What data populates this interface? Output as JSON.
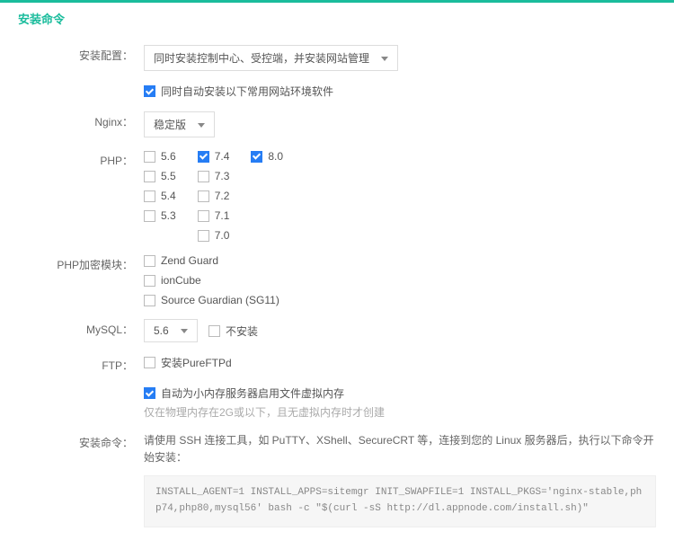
{
  "title": "安装命令",
  "rows": {
    "config_label": "安装配置：",
    "config_select": "同时安装控制中心、受控端，并安装网站管理",
    "auto_install_label": "同时自动安装以下常用网站环境软件",
    "nginx_label": "Nginx：",
    "nginx_select": "稳定版",
    "php_label": "PHP：",
    "php": {
      "col1": [
        {
          "v": "5.6",
          "c": false
        },
        {
          "v": "5.5",
          "c": false
        },
        {
          "v": "5.4",
          "c": false
        },
        {
          "v": "5.3",
          "c": false
        }
      ],
      "col2": [
        {
          "v": "7.4",
          "c": true
        },
        {
          "v": "7.3",
          "c": false
        },
        {
          "v": "7.2",
          "c": false
        },
        {
          "v": "7.1",
          "c": false
        },
        {
          "v": "7.0",
          "c": false
        }
      ],
      "col3": [
        {
          "v": "8.0",
          "c": true
        }
      ]
    },
    "enc_label": "PHP加密模块：",
    "enc": [
      {
        "v": "Zend Guard",
        "c": false
      },
      {
        "v": "ionCube",
        "c": false
      },
      {
        "v": "Source Guardian (SG11)",
        "c": false
      }
    ],
    "mysql_label": "MySQL：",
    "mysql_select": "5.6",
    "mysql_noinstall": "不安装",
    "ftp_label": "FTP：",
    "ftp_option": "安装PureFTPd",
    "swap_label": "自动为小内存服务器启用文件虚拟内存",
    "swap_hint": "仅在物理内存在2G或以下，且无虚拟内存时才创建",
    "cmd_label": "安装命令：",
    "cmd_instruction": "请使用 SSH 连接工具，如 PuTTY、XShell、SecureCRT 等，连接到您的 Linux 服务器后，执行以下命令开始安装：",
    "cmd_code": "INSTALL_AGENT=1 INSTALL_APPS=sitemgr INIT_SWAPFILE=1 INSTALL_PKGS='nginx-stable,php74,php80,mysql56' bash -c \"$(curl -sS http://dl.appnode.com/install.sh)\""
  }
}
